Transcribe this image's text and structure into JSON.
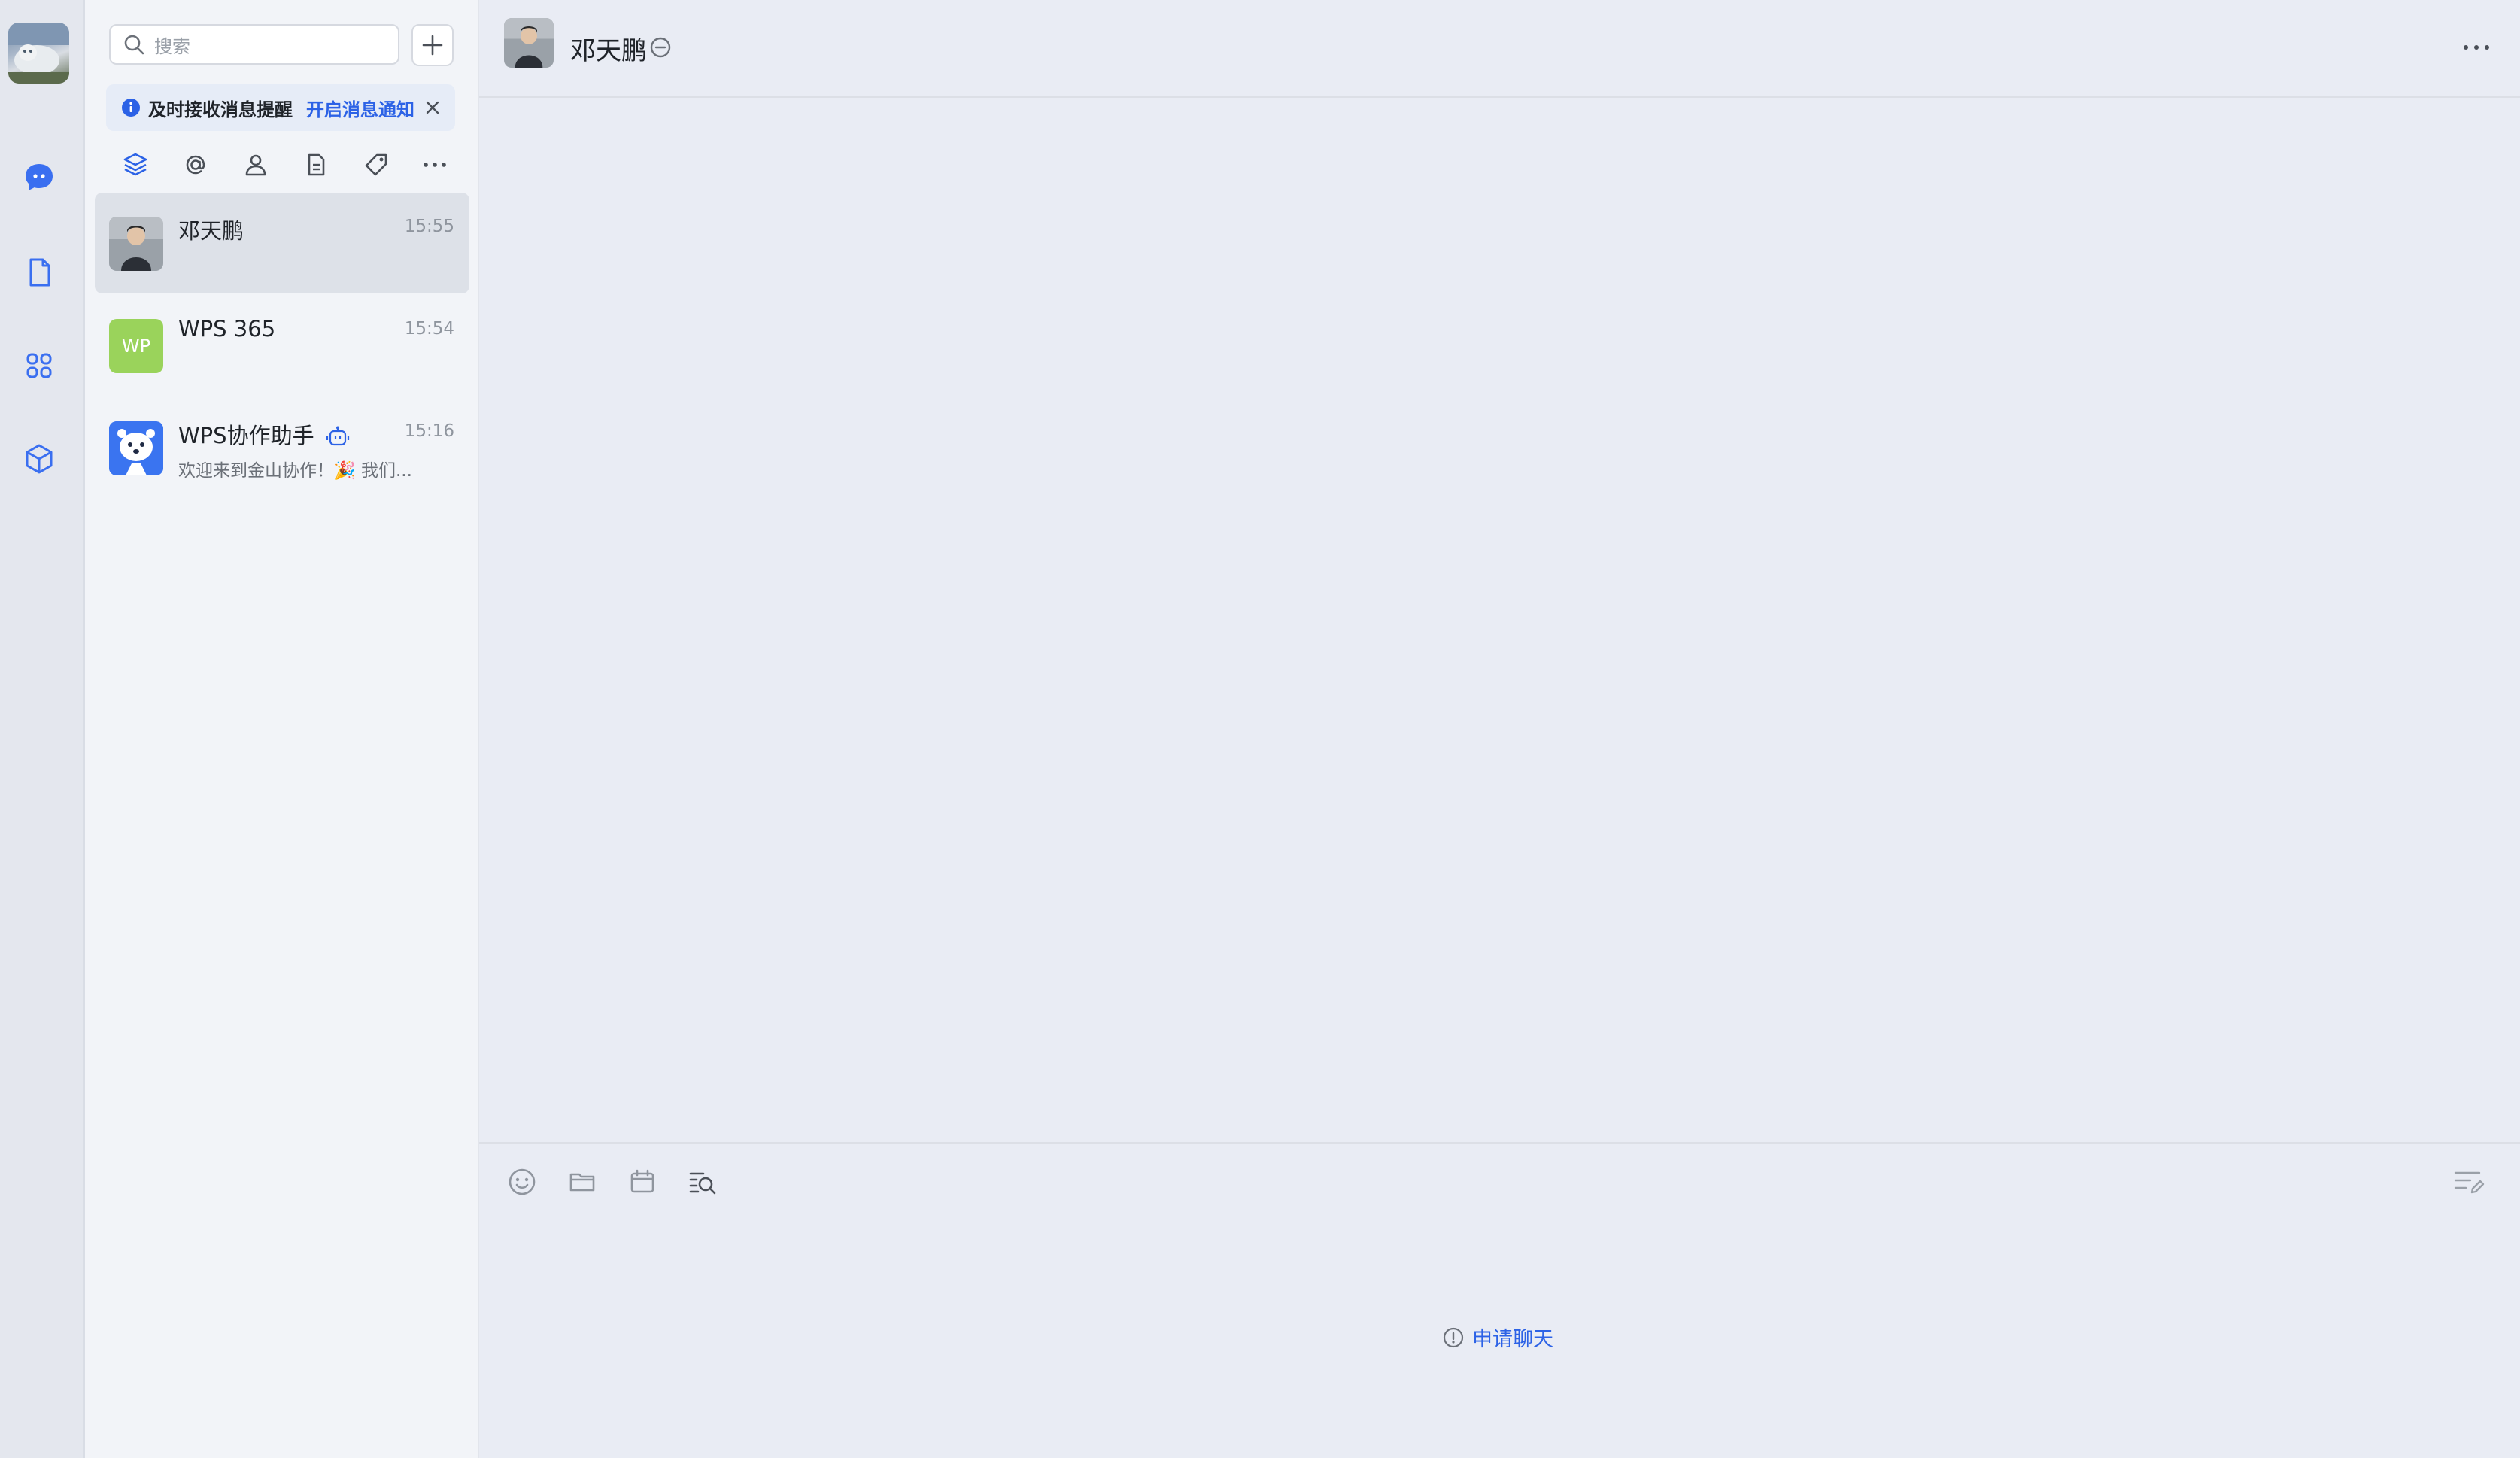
{
  "search": {
    "placeholder": "搜索"
  },
  "notification_banner": {
    "text": "及时接收消息提醒",
    "link": "开启消息通知"
  },
  "conversations": [
    {
      "name": "邓天鹏",
      "time": "15:55",
      "preview": "",
      "active": true
    },
    {
      "name": "WPS 365",
      "time": "15:54",
      "preview": "",
      "avatar_text": "WP",
      "avatar_color": "#9ad35b"
    },
    {
      "name": "WPS协作助手",
      "time": "15:16",
      "preview": "欢迎来到金山协作！🎉 我们..."
    }
  ],
  "chat": {
    "title": "邓天鹏",
    "request_chat_label": "申请聊天"
  },
  "colors": {
    "accent": "#2c62e6",
    "rail_bg": "#e4e7ee",
    "list_bg": "#f2f4f8",
    "chat_bg": "#e9ecf4"
  }
}
